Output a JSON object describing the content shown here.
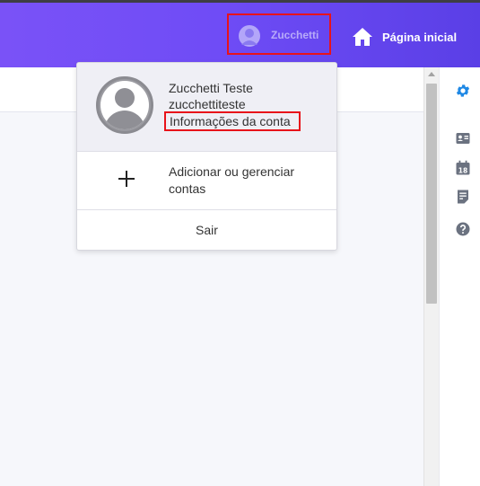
{
  "header": {
    "user_button_label": "Zucchetti",
    "home_label": "Página inicial"
  },
  "dropdown": {
    "full_name": "Zucchetti Teste",
    "username": "zucchettiteste",
    "account_info_label": "Informações da conta",
    "add_accounts_label": "Adicionar ou gerenciar contas",
    "logout_label": "Sair"
  },
  "right_rail": {
    "icons": [
      "gear-icon",
      "contact-card-icon",
      "calendar-icon",
      "form-icon",
      "help-icon"
    ],
    "calendar_day": "18"
  },
  "colors": {
    "header_start": "#7a52f7",
    "header_end": "#5a3fe6",
    "highlight": "#e8131a",
    "rail_gear": "#1e88e5",
    "rail_icon": "#6b7280"
  }
}
